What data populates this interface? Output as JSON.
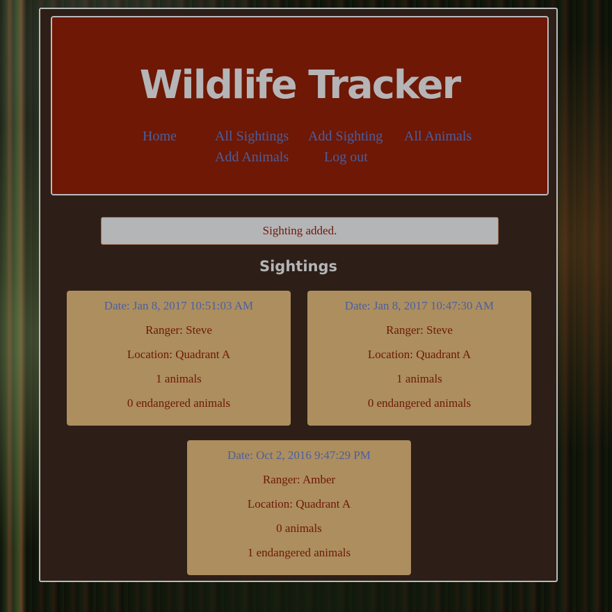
{
  "header": {
    "title": "Wildlife Tracker",
    "nav": [
      "Home",
      "All Sightings",
      "Add Sighting",
      "All Animals",
      "Add Animals",
      "Log out"
    ]
  },
  "flash": "Sighting added.",
  "sightings_heading": "Sightings",
  "sightings": [
    {
      "date": "Date: Jan 8, 2017 10:51:03 AM",
      "ranger": "Ranger: Steve",
      "location": "Location: Quadrant A",
      "animals": "1 animals",
      "endangered": "0 endangered animals"
    },
    {
      "date": "Date: Jan 8, 2017 10:47:30 AM",
      "ranger": "Ranger: Steve",
      "location": "Location: Quadrant A",
      "animals": "1 animals",
      "endangered": "0 endangered animals"
    },
    {
      "date": "Date: Oct 2, 2016 9:47:29 PM",
      "ranger": "Ranger: Amber",
      "location": "Location: Quadrant A",
      "animals": "0 animals",
      "endangered": "1 endangered animals"
    }
  ],
  "colors": {
    "header_bg": "#6e1805",
    "panel_bg": "#2d1f17",
    "card_bg": "#ac8e5f",
    "link": "#4a5fa0",
    "title": "#b5b5b7",
    "flash_bg": "#b4b5b7"
  }
}
